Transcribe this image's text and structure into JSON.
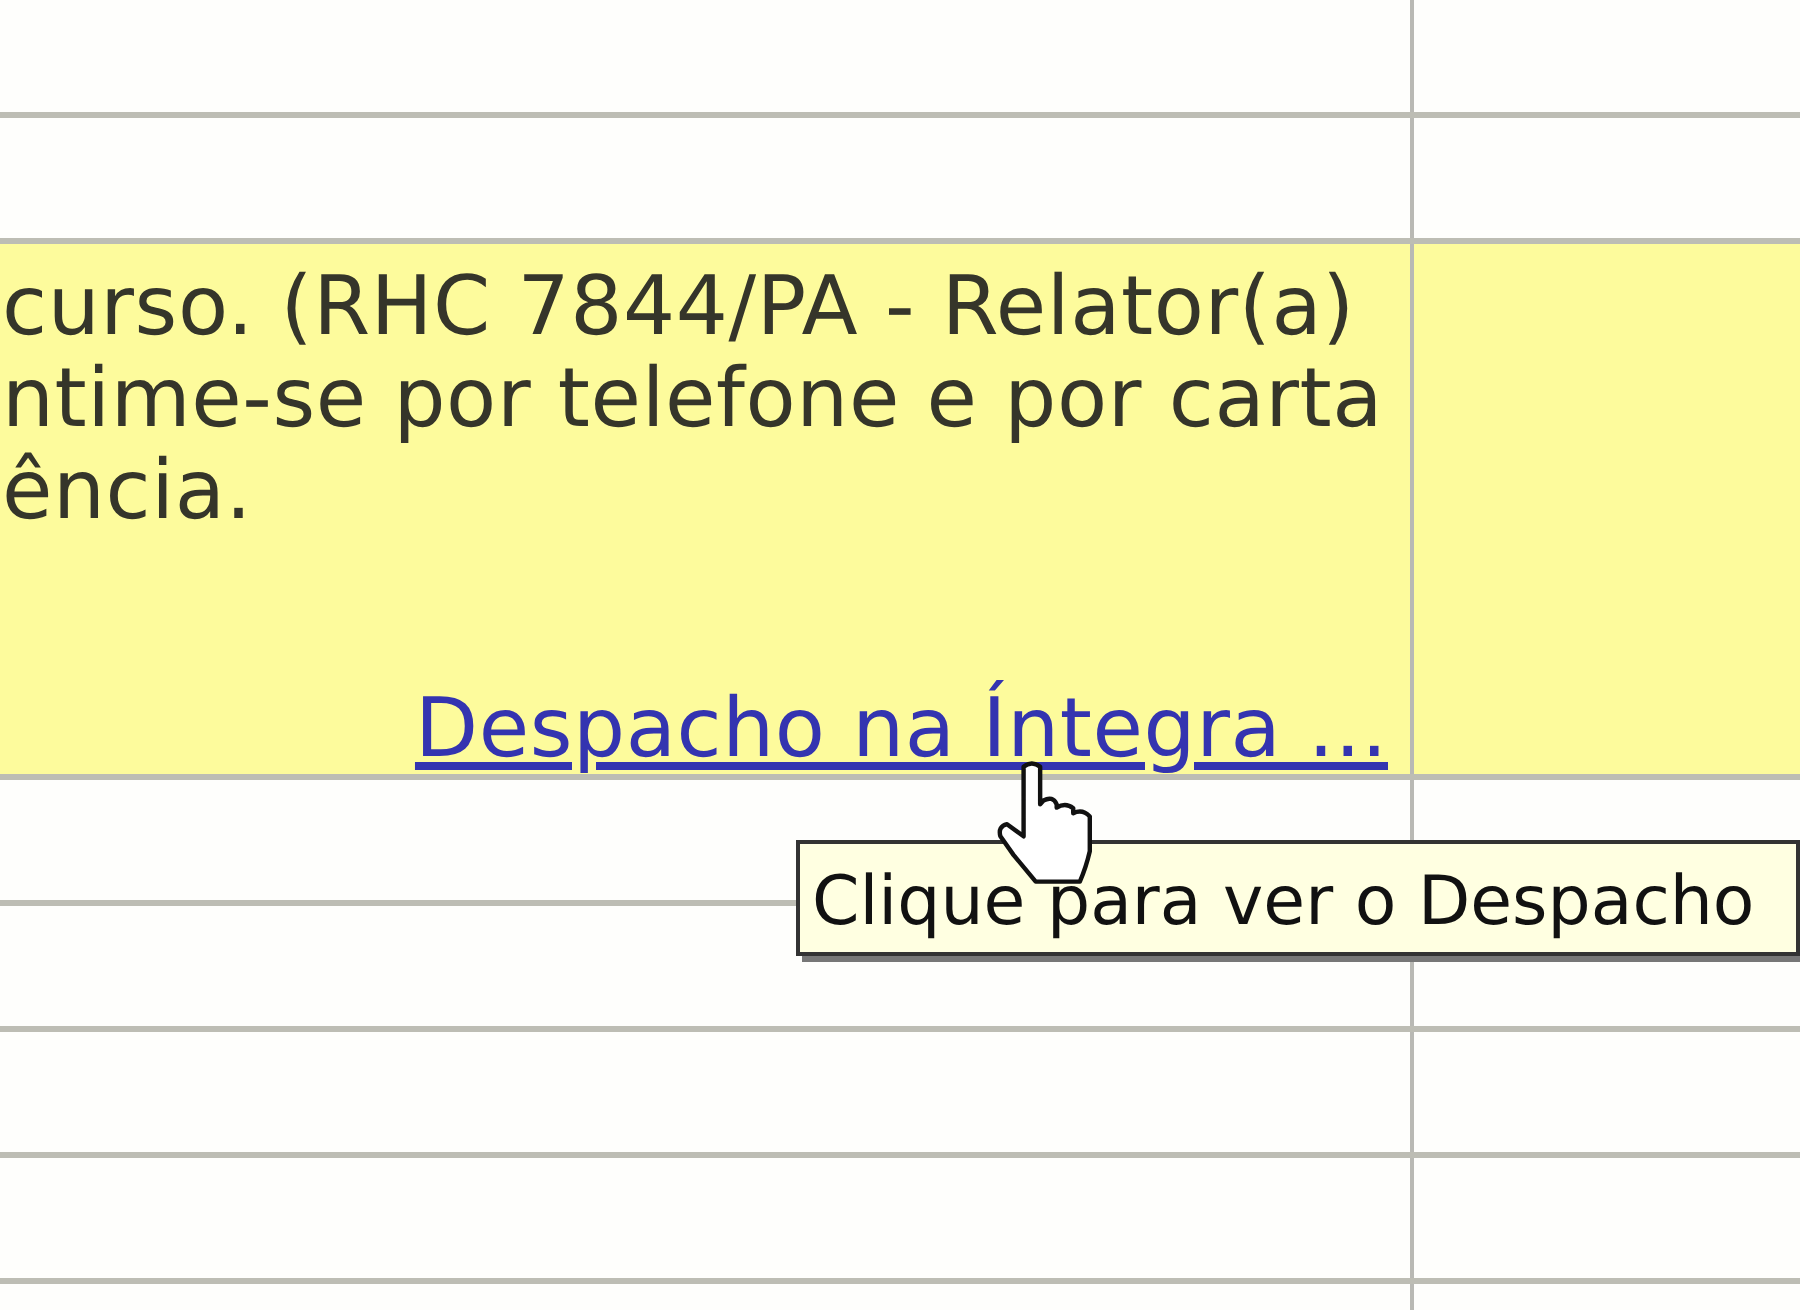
{
  "table": {
    "rows": [
      {
        "highlighted": false
      },
      {
        "highlighted": false
      },
      {
        "highlighted": true,
        "text_lines": [
          "curso. (RHC 7844/PA - Relator(a)",
          "ntime-se por telefone e por carta",
          "ência."
        ],
        "link": "Despacho na Íntegra ..."
      },
      {
        "highlighted": false
      },
      {
        "highlighted": false
      },
      {
        "highlighted": false
      },
      {
        "highlighted": false
      },
      {
        "highlighted": false
      }
    ]
  },
  "tooltip": {
    "text": "Clique para ver o Despacho"
  }
}
